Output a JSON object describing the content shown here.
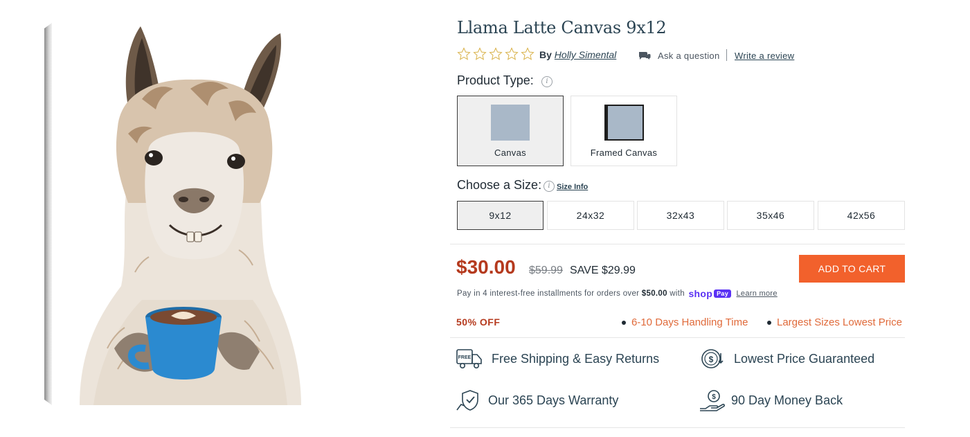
{
  "product": {
    "title": "Llama Latte Canvas 9x12",
    "by_label": "By",
    "author": "Holly Simental",
    "rating_stars": 0,
    "ask_question": "Ask a question",
    "write_review": "Write a review"
  },
  "options": {
    "product_type_label": "Product Type:",
    "product_types": [
      {
        "label": "Canvas",
        "selected": true
      },
      {
        "label": "Framed Canvas",
        "selected": false
      }
    ],
    "size_label": "Choose a Size:",
    "size_info": "Size Info",
    "sizes": [
      {
        "label": "9x12",
        "selected": true
      },
      {
        "label": "24x32",
        "selected": false
      },
      {
        "label": "32x43",
        "selected": false
      },
      {
        "label": "35x46",
        "selected": false
      },
      {
        "label": "42x56",
        "selected": false
      }
    ]
  },
  "pricing": {
    "price": "$30.00",
    "old_price": "$59.99",
    "save": "SAVE $29.99",
    "add_to_cart": "ADD TO CART",
    "installments_text": "Pay in 4 interest-free installments for orders over",
    "installments_amount": "$50.00",
    "installments_with": "with",
    "shop_pay_text": "shop",
    "shop_pay_badge": "Pay",
    "learn_more": "Learn more",
    "discount": "50% OFF",
    "promos": [
      "6-10 Days Handling Time",
      "Largest Sizes Lowest Price"
    ]
  },
  "features": [
    {
      "icon": "truck-icon",
      "label": "Free Shipping & Easy Returns",
      "badge": "FREE"
    },
    {
      "icon": "price-guarantee-icon",
      "label": "Lowest Price Guaranteed"
    },
    {
      "icon": "warranty-shield-icon",
      "label": "Our 365 Days Warranty"
    },
    {
      "icon": "money-back-icon",
      "label": "90 Day Money Back"
    }
  ],
  "colors": {
    "price": "#b53a1e",
    "cart_button": "#f2612c",
    "promo": "#e06a3a",
    "shop_pay": "#5a31f4",
    "title": "#2b4453"
  }
}
